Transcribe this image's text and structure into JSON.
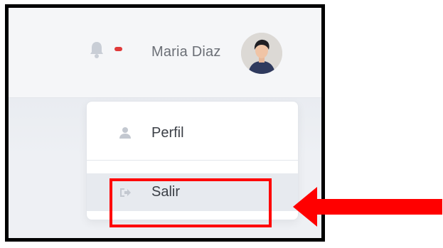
{
  "header": {
    "user_name": "Maria Diaz",
    "notification_indicator": "active"
  },
  "menu": {
    "items": [
      {
        "label": "Perfil",
        "icon": "user-icon"
      },
      {
        "label": "Salir",
        "icon": "logout-icon"
      }
    ],
    "highlighted_item": "Salir"
  },
  "annotation": {
    "highlight_color": "#ff0000",
    "arrow_color": "#ff0000",
    "target": "Salir"
  },
  "colors": {
    "notification_dot": "#e03a3a",
    "menu_hover_bg": "#e7eaef",
    "icon_muted": "#c3c8d0",
    "text_primary": "#3b3f46",
    "text_username": "#6b6f76"
  }
}
